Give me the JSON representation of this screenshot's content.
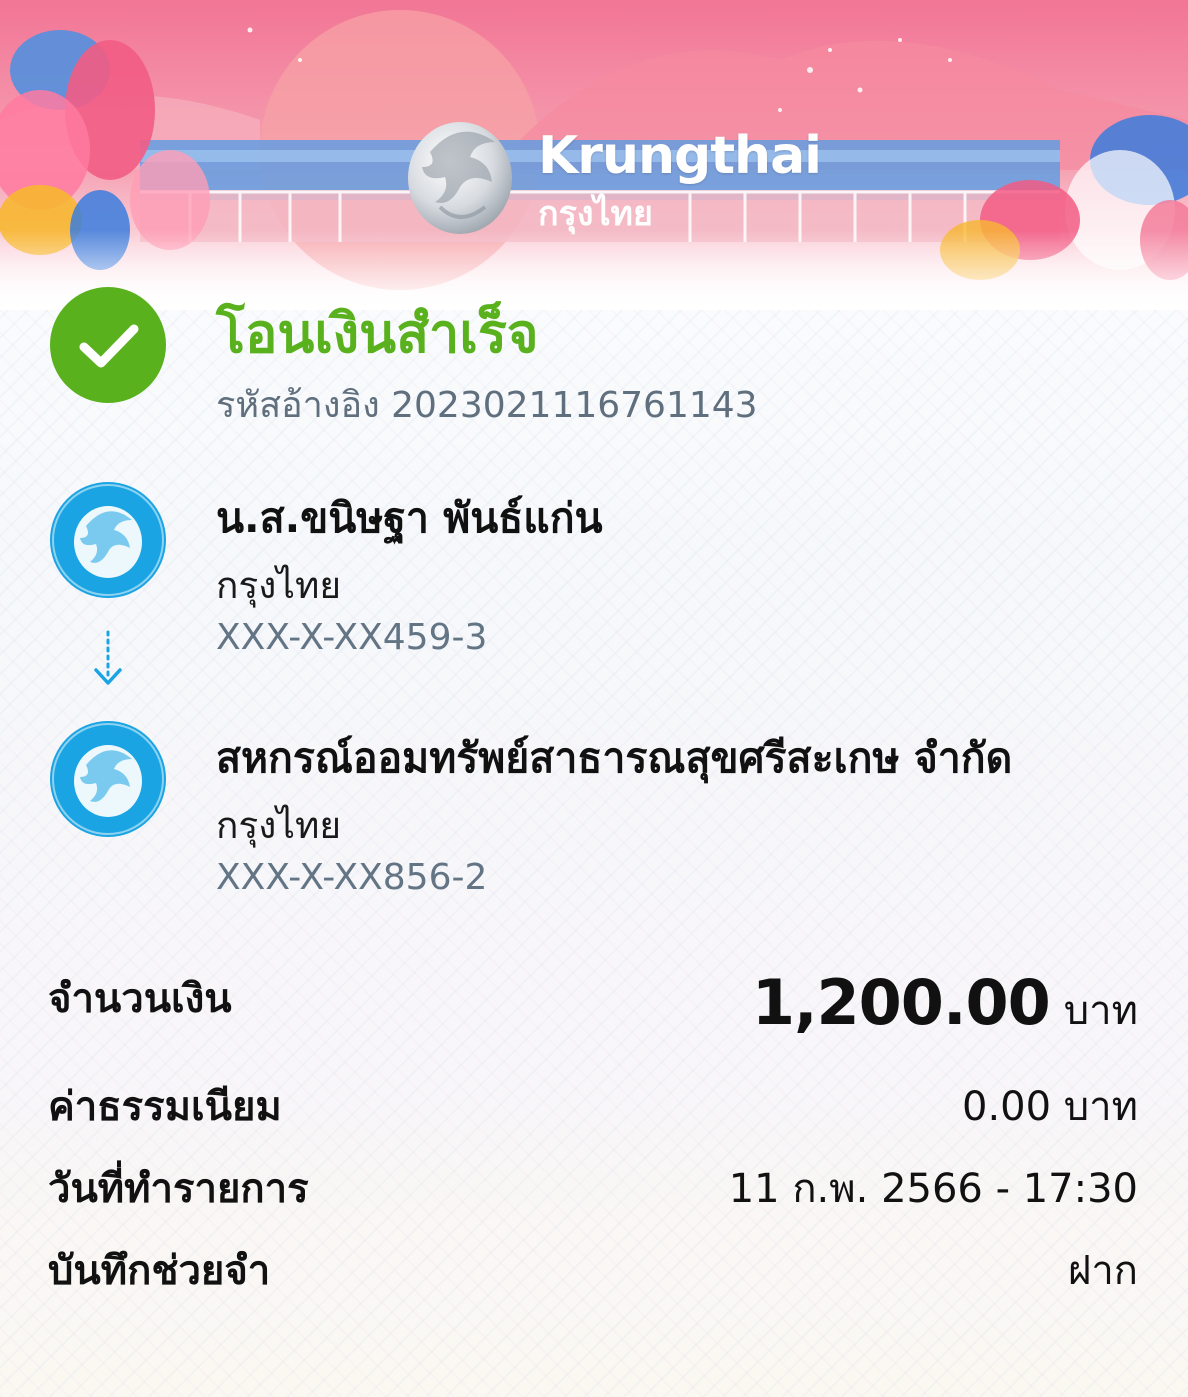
{
  "brand": {
    "name_en": "Krungthai",
    "name_th": "กรุงไทย"
  },
  "status": {
    "title": "โอนเงินสำเร็จ",
    "ref_label": "รหัสอ้างอิง",
    "ref_number": "2023021116761143"
  },
  "sender": {
    "name": "น.ส.ขนิษฐา พันธ์แก่น",
    "bank": "กรุงไทย",
    "account": "XXX-X-XX459-3"
  },
  "receiver": {
    "name": "สหกรณ์ออมทรัพย์สาธารณสุขศรีสะเกษ จำกัด",
    "bank": "กรุงไทย",
    "account": "XXX-X-XX856-2"
  },
  "details": {
    "amount_label": "จำนวนเงิน",
    "amount_value": "1,200.00",
    "amount_unit": "บาท",
    "fee_label": "ค่าธรรมเนียม",
    "fee_value": "0.00 บาท",
    "date_label": "วันที่ทำรายการ",
    "date_value": "11 ก.พ. 2566 - 17:30",
    "memo_label": "บันทึกช่วยจำ",
    "memo_value": "ฝาก"
  },
  "colors": {
    "success_green": "#5ab11e",
    "bank_blue": "#1ba4e3",
    "header_pink": "#f06a8a"
  },
  "icons": {
    "status": "check-icon",
    "bank_logo": "krungthai-phoenix-icon",
    "arrow": "arrow-down-icon"
  }
}
